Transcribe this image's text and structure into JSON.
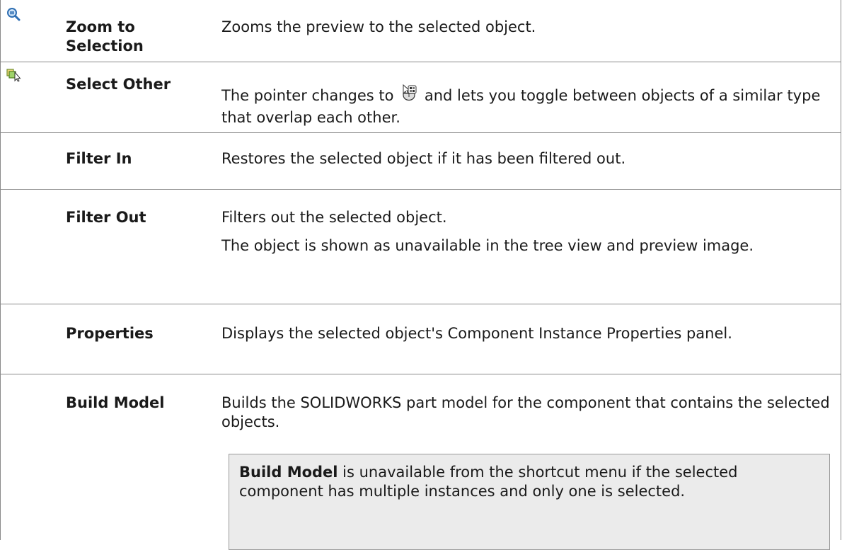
{
  "rows": [
    {
      "name": "Zoom to Selection",
      "icon": "zoom-selection-icon",
      "description": [
        "Zooms the preview to the selected object."
      ]
    },
    {
      "name": "Select Other",
      "icon": "select-other-icon",
      "description_before": "The pointer changes to",
      "description_pointer_icon": "select-other-pointer-icon",
      "description_after": "and lets you toggle between objects of a similar type that overlap each other."
    },
    {
      "name": "Filter In",
      "description": [
        "Restores the selected object if it has been filtered out."
      ]
    },
    {
      "name": "Filter Out",
      "description": [
        "Filters out the selected object.",
        "The object is shown as unavailable in the tree view and preview image."
      ]
    },
    {
      "name": "Properties",
      "description": [
        "Displays the selected object's Component Instance Properties panel."
      ]
    },
    {
      "name": "Build Model",
      "description": [
        "Builds the SOLIDWORKS part model for the component that contains the selected objects."
      ],
      "note": {
        "bold": "Build Model",
        "text": " is unavailable from the shortcut menu if the selected component has multiple instances and only one is selected."
      }
    }
  ],
  "colors": {
    "border": "#8a8a8a",
    "note_background": "#ebebeb"
  }
}
